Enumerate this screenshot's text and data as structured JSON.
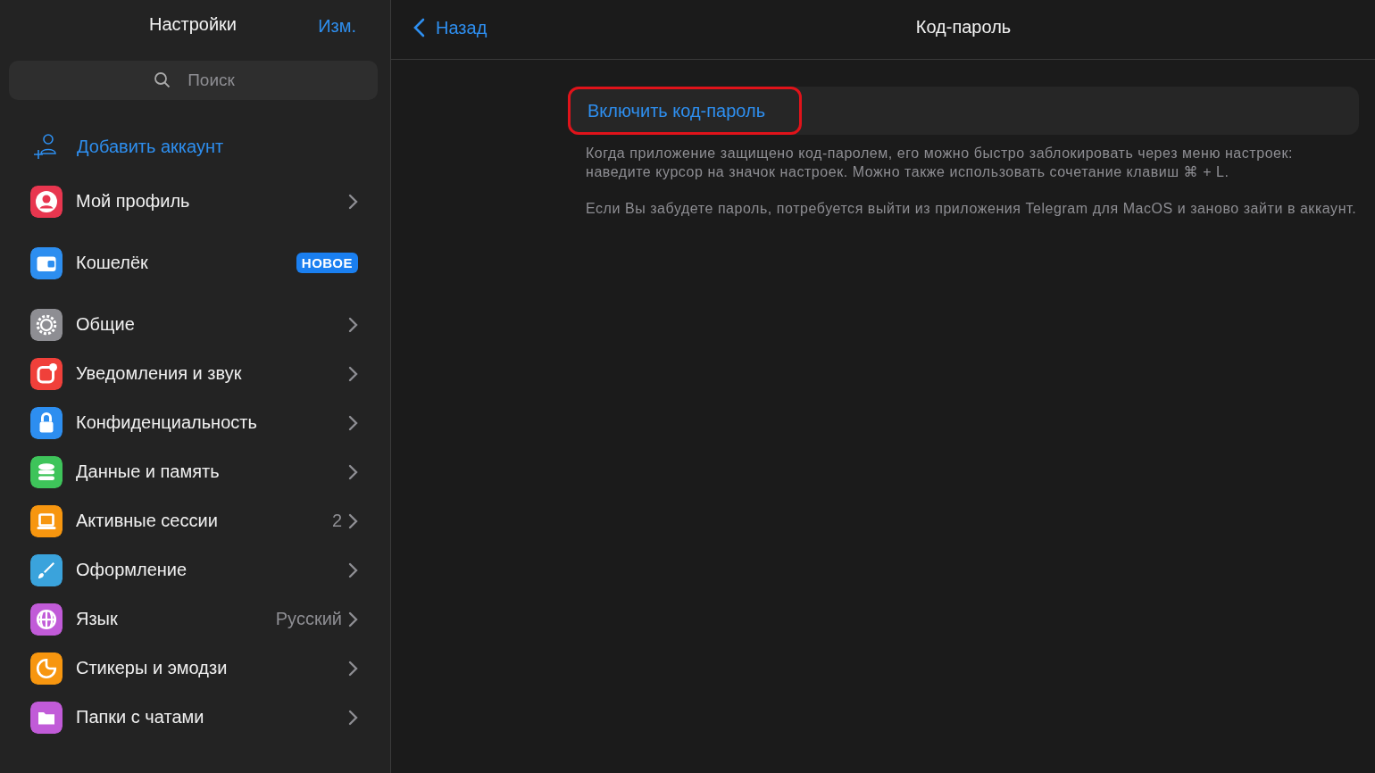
{
  "sidebar": {
    "title": "Настройки",
    "edit_button": "Изм.",
    "search": {
      "placeholder": "Поиск"
    },
    "add_account": "Добавить аккаунт",
    "groups": [
      [
        {
          "kind": "profile",
          "label": "Мой профиль",
          "color": "#e8364f",
          "chevron": true
        }
      ],
      [
        {
          "kind": "wallet",
          "label": "Кошелёк",
          "color": "#2d8ef0",
          "badge": "НОВОЕ",
          "chevron": false
        }
      ],
      [
        {
          "kind": "gear",
          "label": "Общие",
          "color": "#8e8e93",
          "chevron": true
        },
        {
          "kind": "bell",
          "label": "Уведомления и звук",
          "color": "#f0403a",
          "chevron": true
        },
        {
          "kind": "lock",
          "label": "Конфиденциальность",
          "color": "#2d8ef0",
          "chevron": true
        },
        {
          "kind": "database",
          "label": "Данные и память",
          "color": "#3ec45a",
          "chevron": true
        },
        {
          "kind": "laptop",
          "label": "Активные сессии",
          "color": "#f7960f",
          "value": "2",
          "chevron": true
        },
        {
          "kind": "brush",
          "label": "Оформление",
          "color": "#3aa3dc",
          "chevron": true
        },
        {
          "kind": "globe",
          "label": "Язык",
          "color": "#c15bd8",
          "value": "Русский",
          "chevron": true
        },
        {
          "kind": "sticker",
          "label": "Стикеры и эмодзи",
          "color": "#f7960f",
          "chevron": true
        },
        {
          "kind": "folder",
          "label": "Папки с чатами",
          "color": "#c15bd8",
          "chevron": true
        }
      ]
    ]
  },
  "main": {
    "back": "Назад",
    "title": "Код-пароль",
    "enable_button": {
      "label": "Включить код-пароль",
      "highlighted": true
    },
    "notes": [
      "Когда приложение защищено код-паролем, его можно быстро заблокировать через меню настроек: наведите курсор на значок настроек. Можно также использовать сочетание клавиш ⌘ + L.",
      "Если Вы забудете пароль, потребуется выйти из приложения Telegram для MacOS и заново зайти в аккаунт."
    ]
  }
}
